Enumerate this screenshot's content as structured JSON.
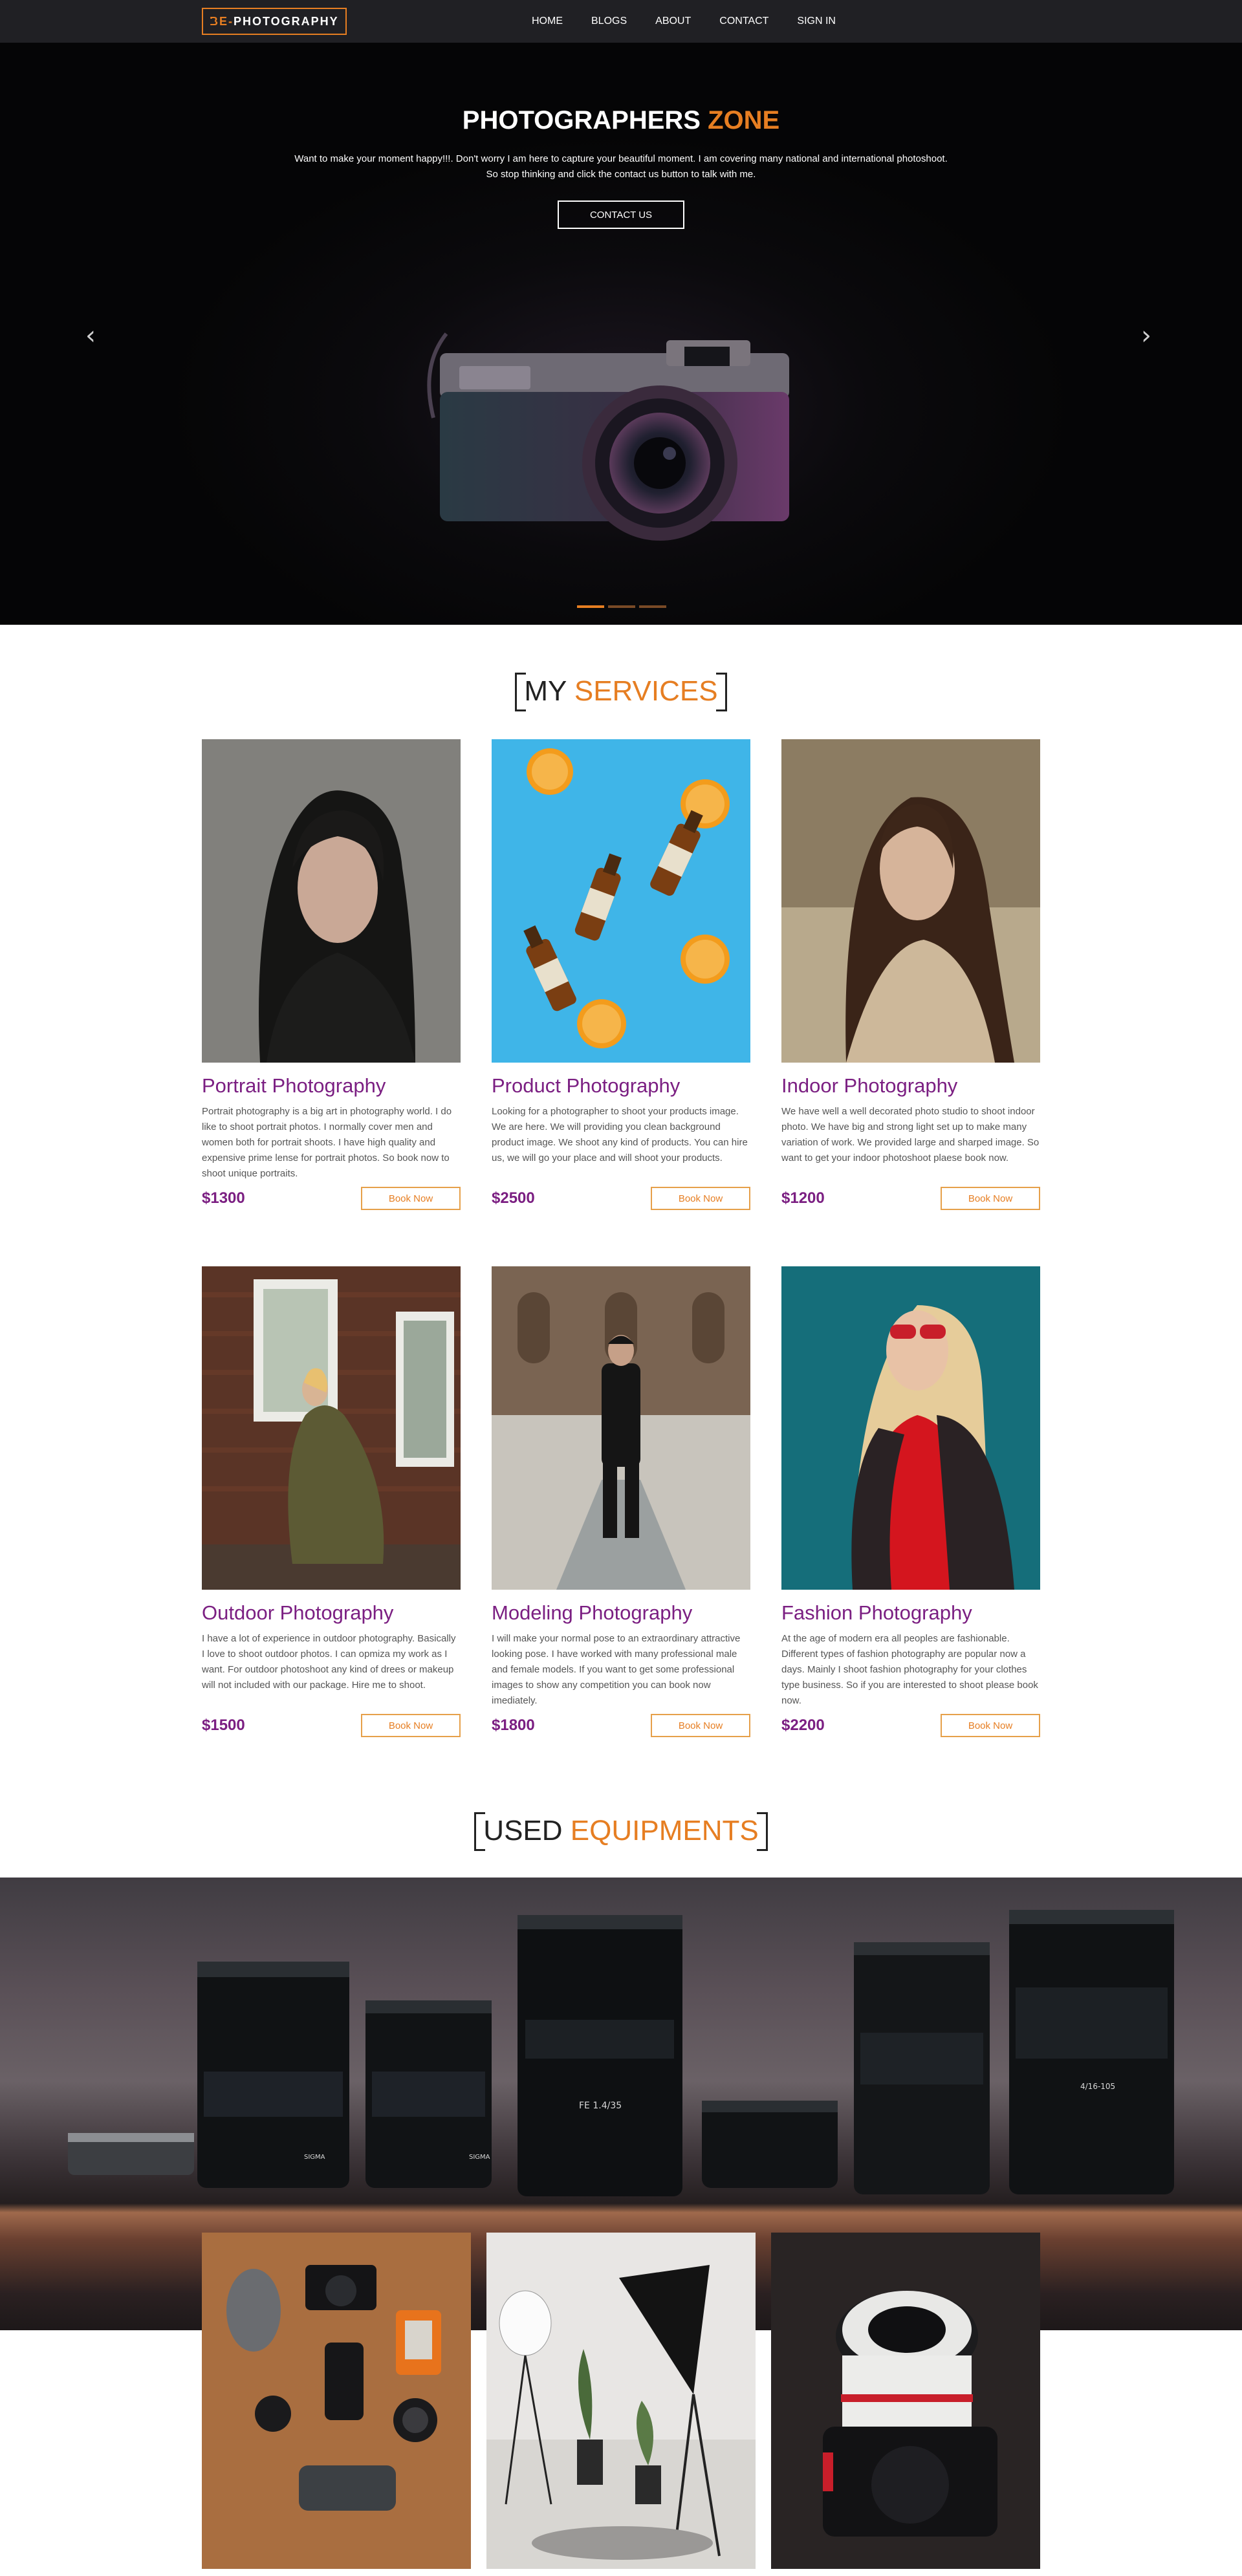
{
  "nav": {
    "logo_prefix": "BE-",
    "logo_suffix": "PHOTOGRAPHY",
    "links": [
      "HOME",
      "BLOGS",
      "ABOUT",
      "CONTACT",
      "SIGN IN"
    ]
  },
  "hero": {
    "title_main": "PHOTOGRAPHERS",
    "title_accent": "ZONE",
    "text_line1": "Want to make your moment happy!!!. Don't worry I am here to capture your beautiful moment. I am covering many national and international photoshoot.",
    "text_line2": "So stop thinking and click the contact us button to talk with me.",
    "button": "CONTACT US",
    "prev_arrow": "‹",
    "next_arrow": "›"
  },
  "services": {
    "heading_main": "MY",
    "heading_accent": "SERVICES",
    "book_label": "Book Now",
    "items": [
      {
        "title": "Portrait Photography",
        "desc": "Portrait photography is a big art in photography world. I do like to shoot portrait photos. I normally cover men and women both for portrait shoots. I have high quality and expensive prime lense for portrait photos. So book now to shoot unique portraits.",
        "price": "$1300"
      },
      {
        "title": "Product Photography",
        "desc": "Looking for a photographer to shoot your products image. We are here. We will providing you clean background product image. We shoot any kind of products. You can hire us, we will go your place and will shoot your products.",
        "price": "$2500"
      },
      {
        "title": "Indoor Photography",
        "desc": "We have well a well decorated photo studio to shoot indoor photo. We have big and strong light set up to make many variation of work. We provided large and sharped image. So want to get your indoor photoshoot plaese book now.",
        "price": "$1200"
      },
      {
        "title": "Outdoor Photography",
        "desc": "I have a lot of experience in outdoor photography. Basically I love to shoot outdoor photos. I can opmiza my work as I want. For outdoor photoshoot any kind of drees or makeup will not included with our package. Hire me to shoot.",
        "price": "$1500"
      },
      {
        "title": "Modeling Photography",
        "desc": "I will make your normal pose to an extraordinary attractive looking pose. I have worked with many professional male and female models. If you want to get some professional images to show any competition you can book now imediately.",
        "price": "$1800"
      },
      {
        "title": "Fashion Photography",
        "desc": "At the age of modern era all peoples are fashionable. Different types of fashion photography are popular now a days. Mainly I shoot fashion photography for your clothes type business. So if you are interested to shoot please book now.",
        "price": "$2200"
      }
    ]
  },
  "equipments": {
    "heading_main": "USED",
    "heading_accent": "EQUIPMENTS",
    "lens_markings": [
      "SIGMA",
      "SIGMA",
      "FE 1.4/35",
      "4/16-105"
    ]
  },
  "colors": {
    "accent": "#e67e22",
    "purple": "#7b1f82",
    "nav_bg": "#202024"
  }
}
